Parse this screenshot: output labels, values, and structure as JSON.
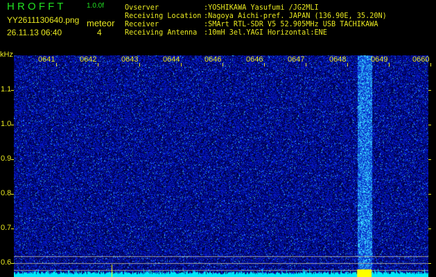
{
  "header": {
    "app_name": "H R O F F T",
    "version": "1.0.0f",
    "filename": "YY2611130640.png",
    "datetime": "26.11.13 06:40",
    "meteor_label": "meteor",
    "meteor_count": "4",
    "info": [
      {
        "label": "Ovserver",
        "value": ":YOSHIKAWA Yasufumi /JG2MLI"
      },
      {
        "label": "Receiving Location",
        "value": ":Nagoya Aichi-pref. JAPAN (136.90E, 35.20N)"
      },
      {
        "label": "Receiver",
        "value": ":SMArt RTL-SDR V5 52.905MHz USB TACHIKAWA"
      },
      {
        "label": "Receiving Antenna",
        "value": ":10mH 3el.YAGI Horizontal:ENE"
      }
    ]
  },
  "chart_data": {
    "type": "heatmap",
    "ylabel": "kHz",
    "yticks": [
      "1.1",
      "1.0",
      "0.9",
      "0.8",
      "0.7",
      "0.6"
    ],
    "ylim": [
      0.56,
      1.2
    ],
    "time_labels": [
      "0641",
      "0642",
      "0643",
      "0644",
      "0646",
      "0646",
      "0647",
      "0648",
      "0649",
      "0660"
    ],
    "meteor_events": [
      {
        "time_fraction": 0.83,
        "width_fraction": 0.035,
        "description": "strong broadband echo"
      }
    ],
    "reference_lines_khz": [
      0.62,
      0.6,
      0.58
    ],
    "colors": {
      "background": "#00008a",
      "noise": "#1a2aff",
      "echo": "#38e0ff",
      "baseline": "#00e8f8",
      "peak": "#ffff00"
    }
  }
}
